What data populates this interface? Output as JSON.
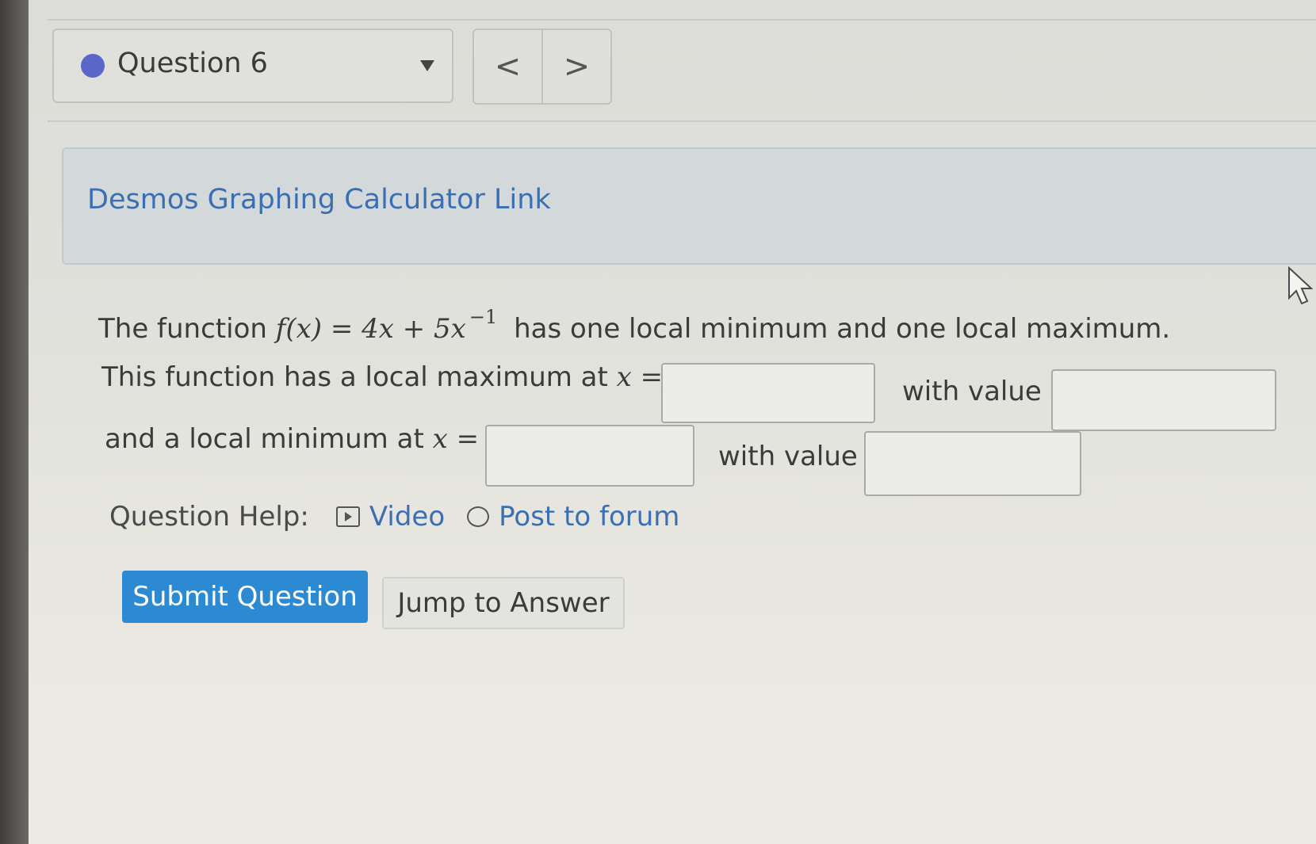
{
  "question_nav": {
    "label": "Question 6",
    "prev_label": "<",
    "next_label": ">"
  },
  "desmos": {
    "link_text": "Desmos Graphing Calculator Link"
  },
  "problem": {
    "line1_prefix": "The function",
    "function_lhs": "f(x) = 4x + 5x",
    "function_exponent": "−1",
    "line1_suffix": "has one local minimum and one local maximum.",
    "line2_prefix": "This function has a local maximum at",
    "line3_prefix": "and a local minimum at",
    "var_eq": "x =",
    "with_value": "with value"
  },
  "answers": {
    "max_x": "",
    "max_value": "",
    "min_x": "",
    "min_value": ""
  },
  "help": {
    "label": "Question Help:",
    "video_label": "Video",
    "forum_label": "Post to forum"
  },
  "buttons": {
    "submit_label": "Submit Question",
    "jump_label": "Jump to Answer"
  },
  "colors": {
    "accent": "#2b8ad2",
    "link": "#3c6fb2",
    "question_dot": "#5a66c8"
  }
}
